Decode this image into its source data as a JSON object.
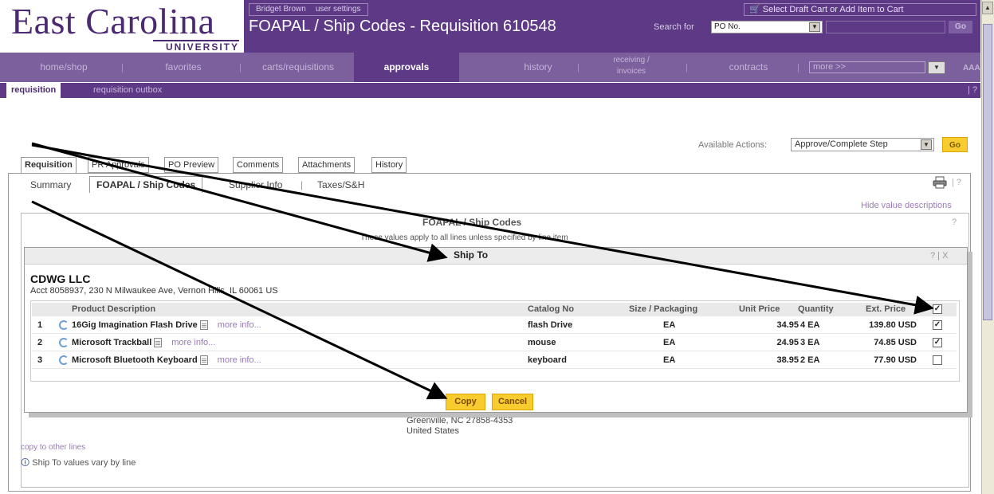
{
  "logo": {
    "main": "East Carolina",
    "sub": "UNIVERSITY"
  },
  "header": {
    "user_name": "Bridget Brown",
    "user_settings": "user settings",
    "page_title": "FOAPAL / Ship Codes - Requisition 610548",
    "cart_link": "Select Draft Cart or Add Item to Cart",
    "search_label": "Search for",
    "search_select": "PO No.",
    "go_label": "Go"
  },
  "nav": {
    "items": [
      "home/shop",
      "favorites",
      "carts/requisitions",
      "approvals",
      "history",
      "receiving / invoices",
      "contracts"
    ],
    "more": "more >>",
    "aaa": "AAA"
  },
  "subnav": {
    "active": "requisition",
    "item": "requisition outbox",
    "help": "| ?"
  },
  "actions": {
    "label": "Available Actions:",
    "selected": "Approve/Complete Step",
    "go": "Go"
  },
  "tabs": [
    "Requisition",
    "PR Approvals",
    "PO Preview",
    "Comments",
    "Attachments",
    "History"
  ],
  "subtabs": {
    "summary": "Summary",
    "active": "FOAPAL / Ship Codes",
    "supplier": "Supplier Info",
    "taxes": "Taxes/S&H"
  },
  "hide_desc": "Hide value descriptions",
  "foapal": {
    "title": "FOAPAL / Ship Codes",
    "subtitle": "These values apply to all lines unless specified by line item"
  },
  "address_tail": {
    "line1": "Greenville, NC 27858-4353",
    "line2": "United States"
  },
  "copy_other": "copy to other lines",
  "ship_vary": "Ship To values vary by line",
  "modal": {
    "title": "Ship To",
    "controls": "? | X",
    "vendor": "CDWG LLC",
    "acct": "Acct 8058937, 230 N Milwaukee Ave, Vernon Hills, IL 60061 US",
    "headers": {
      "desc": "Product Description",
      "catalog": "Catalog No",
      "size": "Size / Packaging",
      "price": "Unit Price",
      "qty": "Quantity",
      "ext": "Ext. Price"
    },
    "header_checked": true,
    "rows": [
      {
        "num": "1",
        "desc": "16Gig Imagination Flash Drive",
        "more": "more info...",
        "catalog": "flash Drive",
        "size": "EA",
        "price": "34.95",
        "qty": "4 EA",
        "ext": "139.80 USD",
        "checked": true
      },
      {
        "num": "2",
        "desc": "Microsoft Trackball",
        "more": "more info...",
        "catalog": "mouse",
        "size": "EA",
        "price": "24.95",
        "qty": "3 EA",
        "ext": "74.85 USD",
        "checked": true
      },
      {
        "num": "3",
        "desc": "Microsoft Bluetooth Keyboard",
        "more": "more info...",
        "catalog": "keyboard",
        "size": "EA",
        "price": "38.95",
        "qty": "2 EA",
        "ext": "77.90 USD",
        "checked": false
      }
    ],
    "copy": "Copy",
    "cancel": "Cancel"
  },
  "colors": {
    "purple": "#5e3a86",
    "nav": "#7c609e",
    "gold": "#f8cc2e",
    "link": "#9a7ab8"
  }
}
